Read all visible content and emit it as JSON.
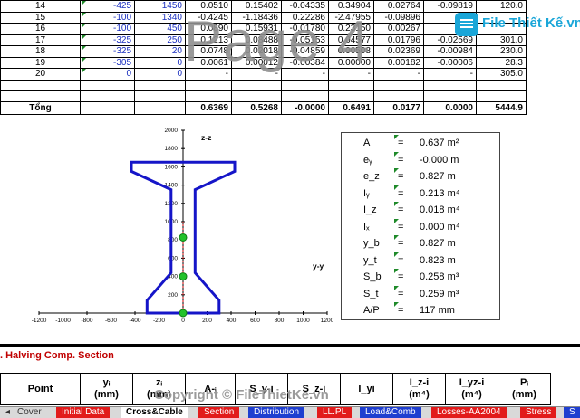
{
  "table": {
    "rows": [
      {
        "pt": "14",
        "y": "-425",
        "z": "1450",
        "c1": "0.0510",
        "c2": "0.15402",
        "c3": "-0.04335",
        "c4": "0.34904",
        "c5": "0.02764",
        "c6": "-0.09819",
        "c7": "120.0"
      },
      {
        "pt": "15",
        "y": "-100",
        "z": "1340",
        "c1": "-0.4245",
        "c2": "-1.18436",
        "c3": "0.22286",
        "c4": "-2.47955",
        "c5": "-0.09896",
        "c6": "",
        "c7": ""
      },
      {
        "pt": "16",
        "y": "-100",
        "z": "450",
        "c1": "0.0890",
        "c2": "0.15931",
        "c3": "-0.01780",
        "c4": "0.23150",
        "c5": "0.00267",
        "c6": "",
        "c7": ""
      },
      {
        "pt": "17",
        "y": "-325",
        "z": "250",
        "c1": "0.1213",
        "c2": "0.08488",
        "c3": "-0.05153",
        "c4": "0.04577",
        "c5": "0.01796",
        "c6": "-0.02569",
        "c7": "301.0"
      },
      {
        "pt": "18",
        "y": "-325",
        "z": "20",
        "c1": "0.0748",
        "c2": "0.02018",
        "c3": "-0.04859",
        "c4": "0.00508",
        "c5": "0.02369",
        "c6": "-0.00984",
        "c7": "230.0"
      },
      {
        "pt": "19",
        "y": "-305",
        "z": "0",
        "c1": "0.0061",
        "c2": "0.00012",
        "c3": "-0.00384",
        "c4": "0.00000",
        "c5": "0.00182",
        "c6": "-0.00006",
        "c7": "28.3"
      },
      {
        "pt": "20",
        "y": "0",
        "z": "0",
        "c1": "-",
        "c2": "-",
        "c3": "-",
        "c4": "-",
        "c5": "-",
        "c6": "-",
        "c7": "305.0"
      }
    ],
    "total": {
      "label": "Tổng",
      "c1": "0.6369",
      "c2": "0.5268",
      "c3": "-0.0000",
      "c4": "0.6491",
      "c5": "0.0177",
      "c6": "0.0000",
      "c7": "5444.9"
    }
  },
  "watermark": "Page 4",
  "logo_text": "File Thiết Kế.vn",
  "chart_data": {
    "type": "diagram",
    "xaxis_ticks": [
      "-1200",
      "-1000",
      "-800",
      "-600",
      "-400",
      "-200",
      "0",
      "200",
      "400",
      "600",
      "800",
      "1000",
      "1200"
    ],
    "yaxis_ticks": [
      "0",
      "200",
      "400",
      "600",
      "800",
      "1000",
      "1200",
      "1400",
      "1600",
      "1800",
      "2000"
    ],
    "label_z": "z-z",
    "label_y": "y-y",
    "xlim": [
      -1200,
      1200
    ],
    "ylim": [
      0,
      2000
    ],
    "section_outline": [
      [
        -300,
        0
      ],
      [
        300,
        0
      ],
      [
        300,
        140
      ],
      [
        100,
        440
      ],
      [
        100,
        1350
      ],
      [
        430,
        1550
      ],
      [
        430,
        1650
      ],
      [
        -430,
        1650
      ],
      [
        -430,
        1550
      ],
      [
        -100,
        1350
      ],
      [
        -100,
        440
      ],
      [
        -300,
        140
      ],
      [
        -300,
        0
      ]
    ],
    "points": [
      [
        0,
        0
      ],
      [
        0,
        400
      ],
      [
        0,
        827
      ]
    ]
  },
  "props": [
    {
      "sym": "A",
      "val": "0.637 m²"
    },
    {
      "sym": "eᵧ",
      "val": "-0.000 m"
    },
    {
      "sym": "e_z",
      "val": "0.827 m"
    },
    {
      "sym": "Iᵧ",
      "val": "0.213 m⁴"
    },
    {
      "sym": "I_z",
      "val": "0.018 m⁴"
    },
    {
      "sym": "Iₓ",
      "val": "0.000 m⁴"
    },
    {
      "sym": "y_b",
      "val": "0.827 m"
    },
    {
      "sym": "y_t",
      "val": "0.823 m"
    },
    {
      "sym": "S_b",
      "val": "0.258 m³"
    },
    {
      "sym": "S_t",
      "val": "0.259 m³"
    },
    {
      "sym": "A/P",
      "val": "117 mm"
    }
  ],
  "props_eq": "=",
  "banner": ". Halving Comp. Section",
  "header_cells": [
    {
      "l1": "Point",
      "l2": ""
    },
    {
      "l1": "yᵢ",
      "l2": "(mm)"
    },
    {
      "l1": "zᵢ",
      "l2": "(mm)"
    },
    {
      "l1": "A-ᵢ",
      "l2": ""
    },
    {
      "l1": "S_y-i",
      "l2": ""
    },
    {
      "l1": "S_z-i",
      "l2": ""
    },
    {
      "l1": "I_yi",
      "l2": ""
    },
    {
      "l1": "I_z-i",
      "l2": "(m⁴)"
    },
    {
      "l1": "I_yz-i",
      "l2": "(m⁴)"
    },
    {
      "l1": "Pᵢ",
      "l2": "(mm)"
    }
  ],
  "copyright": "Copyright © FileThietKe.vn",
  "tabs": [
    {
      "label": "Cover",
      "style": "plain"
    },
    {
      "label": "Initial Data",
      "style": "red"
    },
    {
      "label": "Cross&Cable",
      "style": "act"
    },
    {
      "label": "Section",
      "style": "red"
    },
    {
      "label": "Distribution",
      "style": "blue"
    },
    {
      "label": "LL.PL",
      "style": "red"
    },
    {
      "label": "Load&Comb",
      "style": "blue"
    },
    {
      "label": "Losses-AA2004",
      "style": "red"
    },
    {
      "label": "Stress",
      "style": "red"
    },
    {
      "label": "S",
      "style": "blue"
    }
  ]
}
